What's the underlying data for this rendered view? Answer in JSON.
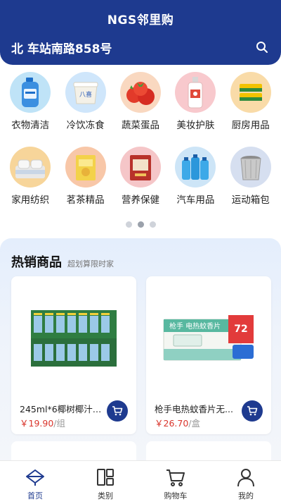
{
  "header": {
    "title": "NGS邻里购",
    "address": "北 车站南路858号"
  },
  "categories": [
    {
      "label": "衣物清洁",
      "icon": "detergent-bottle-icon",
      "bg": "#bfe3f7"
    },
    {
      "label": "冷饮冻食",
      "icon": "ice-cream-tub-icon",
      "bg": "#cfe6fb"
    },
    {
      "label": "蔬菜蛋品",
      "icon": "tomato-icon",
      "bg": "#f9d8c0"
    },
    {
      "label": "美妆护肤",
      "icon": "lotion-bottle-icon",
      "bg": "#f8c9cd"
    },
    {
      "label": "厨房用品",
      "icon": "sponge-icon",
      "bg": "#f9dba8"
    },
    {
      "label": "家用纺织",
      "icon": "bedding-icon",
      "bg": "#f7d59a"
    },
    {
      "label": "茗茶精品",
      "icon": "tea-box-icon",
      "bg": "#f8c7a8"
    },
    {
      "label": "营养保健",
      "icon": "supplement-box-icon",
      "bg": "#f5c6c8"
    },
    {
      "label": "汽车用品",
      "icon": "fluid-bottles-icon",
      "bg": "#cde5f7"
    },
    {
      "label": "运动箱包",
      "icon": "basket-bag-icon",
      "bg": "#d6dff0"
    }
  ],
  "pager": {
    "count": 3,
    "active": 1
  },
  "hot": {
    "title": "热销商品",
    "subtitle": "超划算限时家"
  },
  "products": [
    {
      "name": "245ml*6椰树椰汁利...",
      "price": "￥19.90",
      "unit": "/组"
    },
    {
      "name": "枪手电热蚊香片无...",
      "price": "￥26.70",
      "unit": "/盒"
    }
  ],
  "tabs": [
    {
      "label": "首页",
      "icon": "home-icon",
      "active": true
    },
    {
      "label": "类别",
      "icon": "category-icon",
      "active": false
    },
    {
      "label": "购物车",
      "icon": "cart-icon",
      "active": false
    },
    {
      "label": "我的",
      "icon": "user-icon",
      "active": false
    }
  ],
  "colors": {
    "brand": "#1e3a8f",
    "price": "#d9342b"
  }
}
